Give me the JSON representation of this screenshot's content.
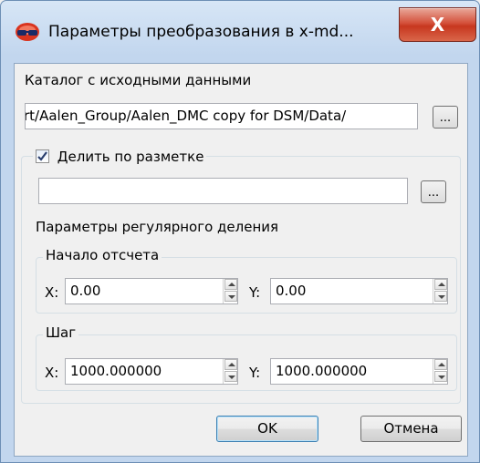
{
  "window": {
    "title": "Параметры преобразования в x-md...",
    "close_label": "X"
  },
  "source": {
    "label": "Каталог с исходными данными",
    "path_value": "rt/Aalen_Group/Aalen_DMC copy for DSM/Data/",
    "browse_label": "..."
  },
  "markup": {
    "checkbox_label": "Делить по разметке",
    "checked": true,
    "path_value": "",
    "browse_label": "..."
  },
  "regular": {
    "title": "Параметры регулярного деления",
    "origin": {
      "title": "Начало отсчета",
      "x_label": "X:",
      "x_value": "0.00",
      "y_label": "Y:",
      "y_value": "0.00"
    },
    "step": {
      "title": "Шаг",
      "x_label": "X:",
      "x_value": "1000.000000",
      "y_label": "Y:",
      "y_value": "1000.000000"
    }
  },
  "buttons": {
    "ok": "OK",
    "cancel": "Отмена"
  }
}
